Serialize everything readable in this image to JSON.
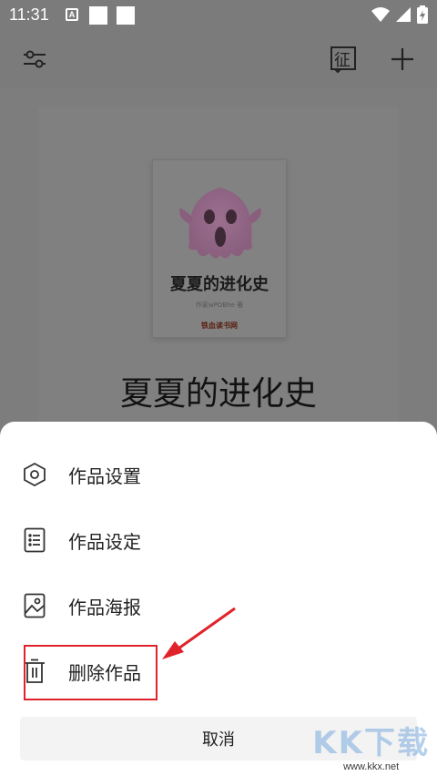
{
  "status_bar": {
    "time": "11:31",
    "notif_a": "A"
  },
  "app_bar": {
    "filter_icon": "sliders-icon",
    "activity_label": "征",
    "add_icon": "plus-icon"
  },
  "book": {
    "cover_title": "夏夏的进化史",
    "cover_author": "作家wPOBhe 著",
    "cover_brand": "铁血读书网",
    "title": "夏夏的进化史"
  },
  "sheet": {
    "items": [
      {
        "label": "作品设置",
        "icon": "hexagon-settings-icon"
      },
      {
        "label": "作品设定",
        "icon": "list-document-icon"
      },
      {
        "label": "作品海报",
        "icon": "image-poster-icon"
      },
      {
        "label": "删除作品",
        "icon": "trash-icon"
      }
    ],
    "cancel": "取消"
  },
  "watermark": {
    "big": "KK下载",
    "url": "www.kkx.net"
  },
  "colors": {
    "highlight": "#e0232a"
  }
}
